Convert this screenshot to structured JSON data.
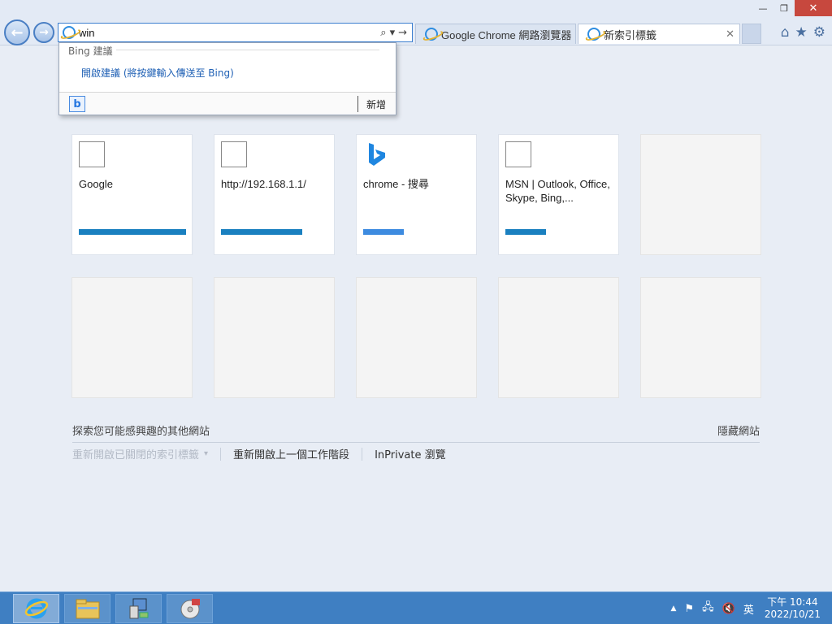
{
  "window": {
    "minimize_glyph": "—",
    "restore_glyph": "❐",
    "close_glyph": "✕"
  },
  "nav": {
    "back_glyph": "←",
    "forward_glyph": "→"
  },
  "address_bar": {
    "value": "win",
    "search_glyph": "⌕",
    "dropdown_glyph": "▾",
    "go_glyph": "→"
  },
  "tabs": [
    {
      "label": "Google Chrome 網路瀏覽器",
      "active": false
    },
    {
      "label": "新索引標籤",
      "active": true,
      "close_glyph": "✕"
    }
  ],
  "toolbar": {
    "home_glyph": "⌂",
    "favorites_glyph": "★",
    "tools_glyph": "⚙"
  },
  "suggestions": {
    "header": "Bing 建議",
    "enable_link": "開啟建議 (將按鍵輸入傳送至 Bing)",
    "bing_glyph": "b",
    "add_label": "新增"
  },
  "tiles": [
    {
      "title": "Google",
      "icon": "blank",
      "bar_fraction": 1.0,
      "bar_color": "#1a80c0"
    },
    {
      "title": "http://192.168.1.1/",
      "icon": "blank",
      "bar_fraction": 0.76,
      "bar_color": "#1a80c0"
    },
    {
      "title": "chrome - 搜尋",
      "icon": "bing",
      "bar_fraction": 0.38,
      "bar_color": "#3d8be0"
    },
    {
      "title": "MSN | Outlook, Office, Skype, Bing,...",
      "icon": "blank",
      "bar_fraction": 0.38,
      "bar_color": "#1a80c0"
    },
    {
      "title": "",
      "icon": "none",
      "bar_fraction": 0
    },
    {
      "title": "",
      "icon": "none",
      "bar_fraction": 0
    },
    {
      "title": "",
      "icon": "none",
      "bar_fraction": 0
    },
    {
      "title": "",
      "icon": "none",
      "bar_fraction": 0
    },
    {
      "title": "",
      "icon": "none",
      "bar_fraction": 0
    },
    {
      "title": "",
      "icon": "none",
      "bar_fraction": 0
    }
  ],
  "footer": {
    "discover": "探索您可能感興趣的其他網站",
    "hide_sites": "隱藏網站",
    "reopen_closed": "重新開啟已關閉的索引標籤",
    "reopen_closed_glyph": "▾",
    "reopen_session": "重新開啟上一個工作階段",
    "inprivate": "InPrivate 瀏覽"
  },
  "taskbar": {
    "tray_expand_glyph": "▲",
    "flag_glyph": "⚑",
    "network_glyph": "🖧",
    "volume_glyph": "🔇",
    "ime": "英",
    "time": "下午 10:44",
    "date": "2022/10/21"
  },
  "colors": {
    "accent": "#3c7fd0",
    "taskbar": "#3f7fc2",
    "page_bg": "#e8edf5",
    "link": "#2061b5"
  }
}
